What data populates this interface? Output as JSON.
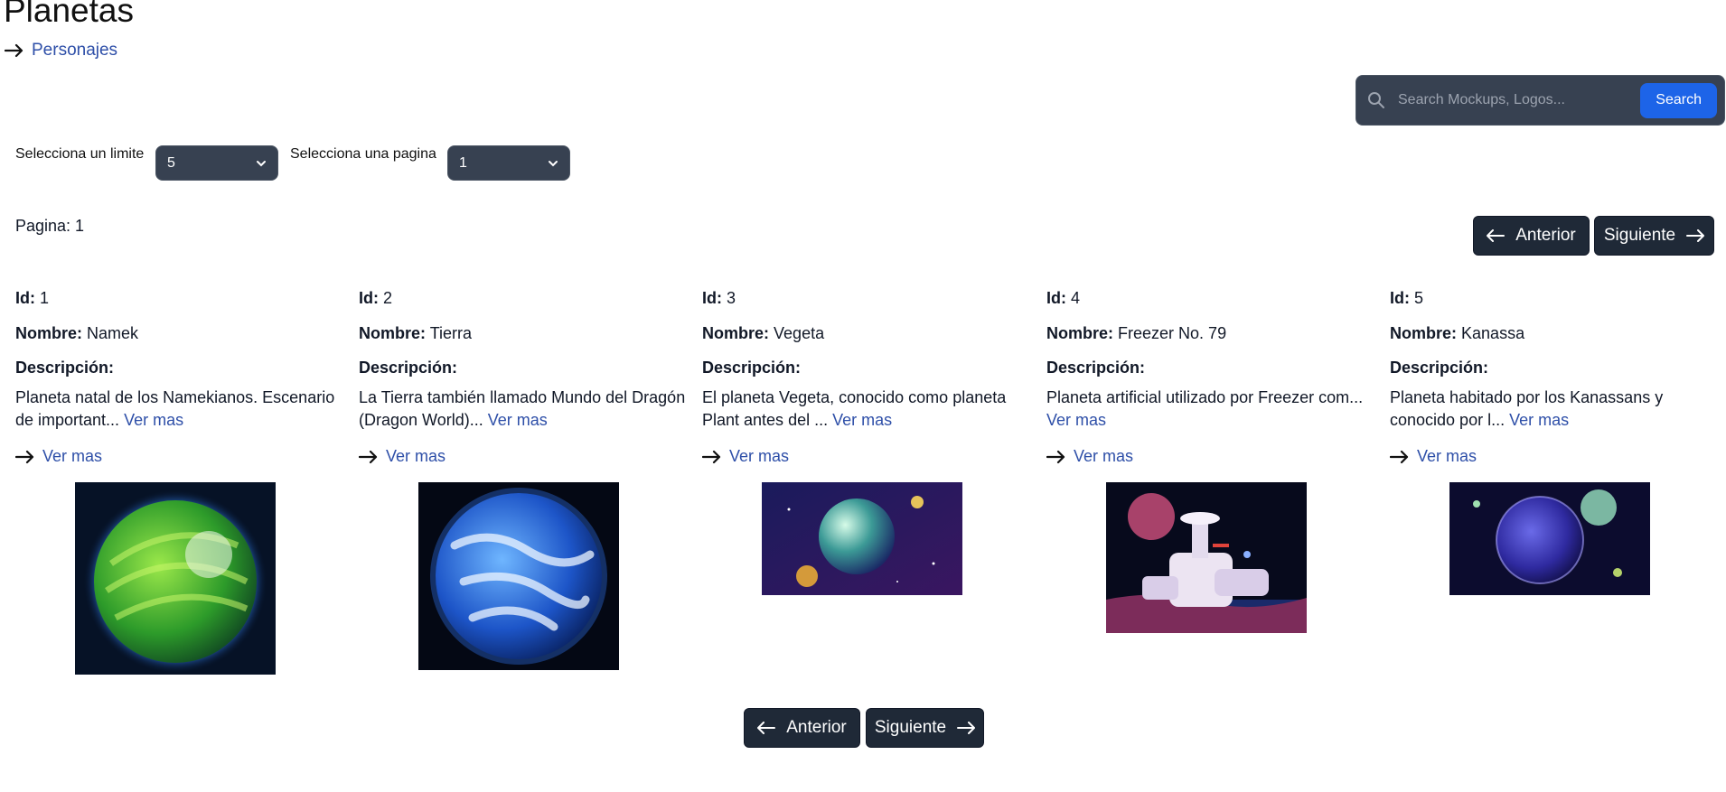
{
  "title": "Planetas",
  "nav_link": "Personajes",
  "search": {
    "placeholder": "Search Mockups, Logos...",
    "button": "Search"
  },
  "limit": {
    "label": "Selecciona un limite",
    "value": "5"
  },
  "page_select": {
    "label": "Selecciona una pagina",
    "value": "1"
  },
  "page_indicator": "Pagina: 1",
  "pagination": {
    "prev": "Anterior",
    "next": "Siguiente"
  },
  "labels": {
    "id": "Id:",
    "name": "Nombre:",
    "description": "Descripción:",
    "more": "Ver mas"
  },
  "planets": [
    {
      "id": "1",
      "name": "Namek",
      "description": "Planeta natal de los Namekianos. Escenario de important...",
      "image_icon": "green-planet-image"
    },
    {
      "id": "2",
      "name": "Tierra",
      "description": "La Tierra también llamado Mundo del Dragón (Dragon World)...",
      "image_icon": "earth-planet-image"
    },
    {
      "id": "3",
      "name": "Vegeta",
      "description": "El planeta Vegeta, conocido como planeta Plant antes del ...",
      "image_icon": "vegeta-planet-image"
    },
    {
      "id": "4",
      "name": "Freezer No. 79",
      "description": "Planeta artificial utilizado por Freezer com...",
      "image_icon": "space-station-image"
    },
    {
      "id": "5",
      "name": "Kanassa",
      "description": "Planeta habitado por los Kanassans y conocido por l...",
      "image_icon": "kanassa-planet-image"
    }
  ],
  "colors": {
    "link": "#2e4fa8",
    "button_dark": "#1f2937",
    "search_bg": "#374151",
    "search_button": "#1d64e8"
  }
}
